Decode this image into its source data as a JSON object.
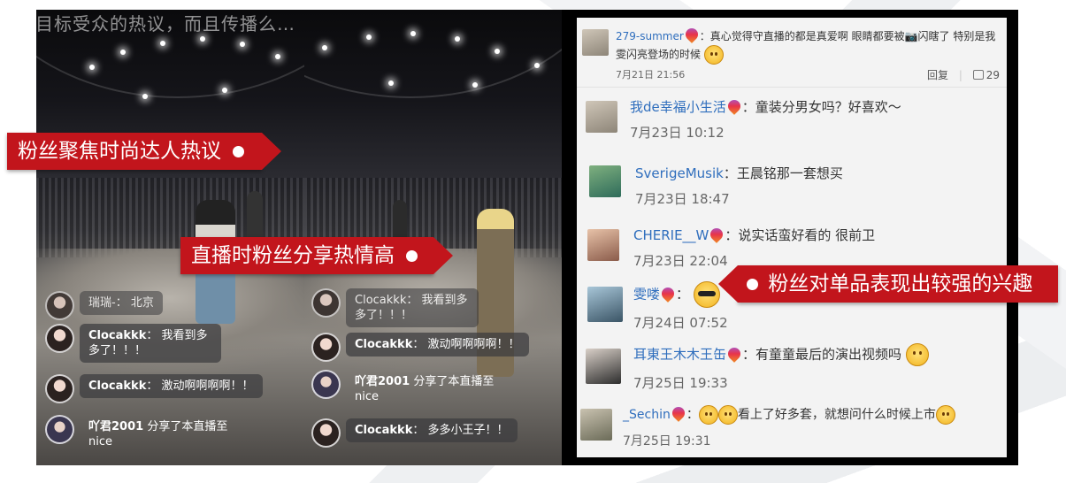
{
  "top_caption": "目标受众的热议，而且传播么…",
  "callouts": {
    "fans_focus": "粉丝聚焦时尚达人热议",
    "live_share": "直播时粉丝分享热情高",
    "single_item": "粉丝对单品表现出较强的兴趣"
  },
  "live_left": {
    "partial_top": "瑞瑞-： 北京",
    "chats": [
      {
        "name": "Clocakkk",
        "text": "我看到多多了！！！"
      },
      {
        "name": "Clocakkk",
        "text": "激动啊啊啊啊！！"
      },
      {
        "name": "吖君2001",
        "text": "分享了本直播至 nice"
      }
    ]
  },
  "live_right": {
    "partial_top": "Clocakkk： 我看到多多了！！！",
    "chats": [
      {
        "name": "Clocakkk",
        "text": "激动啊啊啊啊！！"
      },
      {
        "name": "吖君2001",
        "text": "分享了本直播至 nice"
      },
      {
        "name": "Clocakkk",
        "text": "多多小王子！！"
      }
    ]
  },
  "comments": [
    {
      "name": "279-summer",
      "text": "：真心觉得守直播的都是真爱啊 眼睛都要被📷闪瞎了 特别是我雯闪亮登场的时候",
      "date": "7月21日 21:56",
      "reply": "回复",
      "likes": "29"
    },
    {
      "name": "我de幸福小生活",
      "text": "：童装分男女吗？好喜欢～",
      "date": "7月23日 10:12"
    },
    {
      "name": "SverigeMusik",
      "text": "：王晨铭那一套想买",
      "date": "7月23日 18:47"
    },
    {
      "name": "CHERIE__W",
      "text": "：说实话蛮好看的 很前卫",
      "date": "7月23日 22:04"
    },
    {
      "name": "雯喽",
      "text": "：",
      "date": "7月24日 07:52"
    },
    {
      "name": "耳東王木木王缶",
      "text": "：有童童最后的演出视频吗",
      "date": "7月25日 19:33"
    },
    {
      "name": "_Sechin",
      "text": "看上了好多套，就想问什么时候上市",
      "date": "7月25日 19:31"
    }
  ]
}
